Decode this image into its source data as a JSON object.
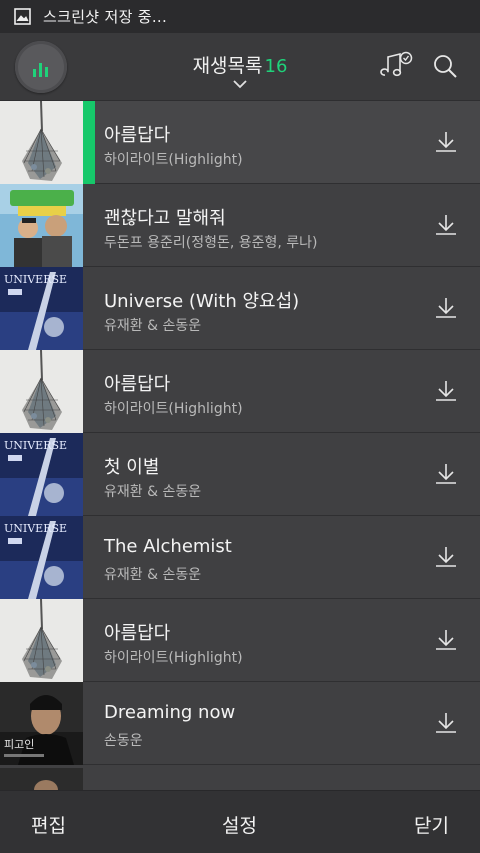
{
  "status_bar": {
    "text": "스크린샷 저장 중..."
  },
  "header": {
    "title": "재생목록",
    "count": "16",
    "accent_color": "#1fd27a"
  },
  "songs": [
    {
      "title": "아름답다",
      "artist": "하이라이트(Highlight)",
      "art": "net-bag",
      "active": true
    },
    {
      "title": "괜찮다고 말해줘",
      "artist": "두돈프 용준리(정형돈, 용준형, 루나)",
      "art": "duo-poster",
      "active": false
    },
    {
      "title": "Universe (With 양요섭)",
      "artist": "유재환 & 손동운",
      "art": "universe-cover",
      "active": false
    },
    {
      "title": "아름답다",
      "artist": "하이라이트(Highlight)",
      "art": "net-bag",
      "active": false
    },
    {
      "title": "첫 이별",
      "artist": "유재환 & 손동운",
      "art": "universe-cover",
      "active": false
    },
    {
      "title": "The Alchemist",
      "artist": "유재환 & 손동운",
      "art": "universe-cover",
      "active": false
    },
    {
      "title": "아름답다",
      "artist": "하이라이트(Highlight)",
      "art": "net-bag",
      "active": false
    },
    {
      "title": "Dreaming now",
      "artist": "손동운",
      "art": "portrait-cover",
      "active": false
    }
  ],
  "footer": {
    "edit_label": "편집",
    "settings_label": "설정",
    "close_label": "닫기"
  }
}
